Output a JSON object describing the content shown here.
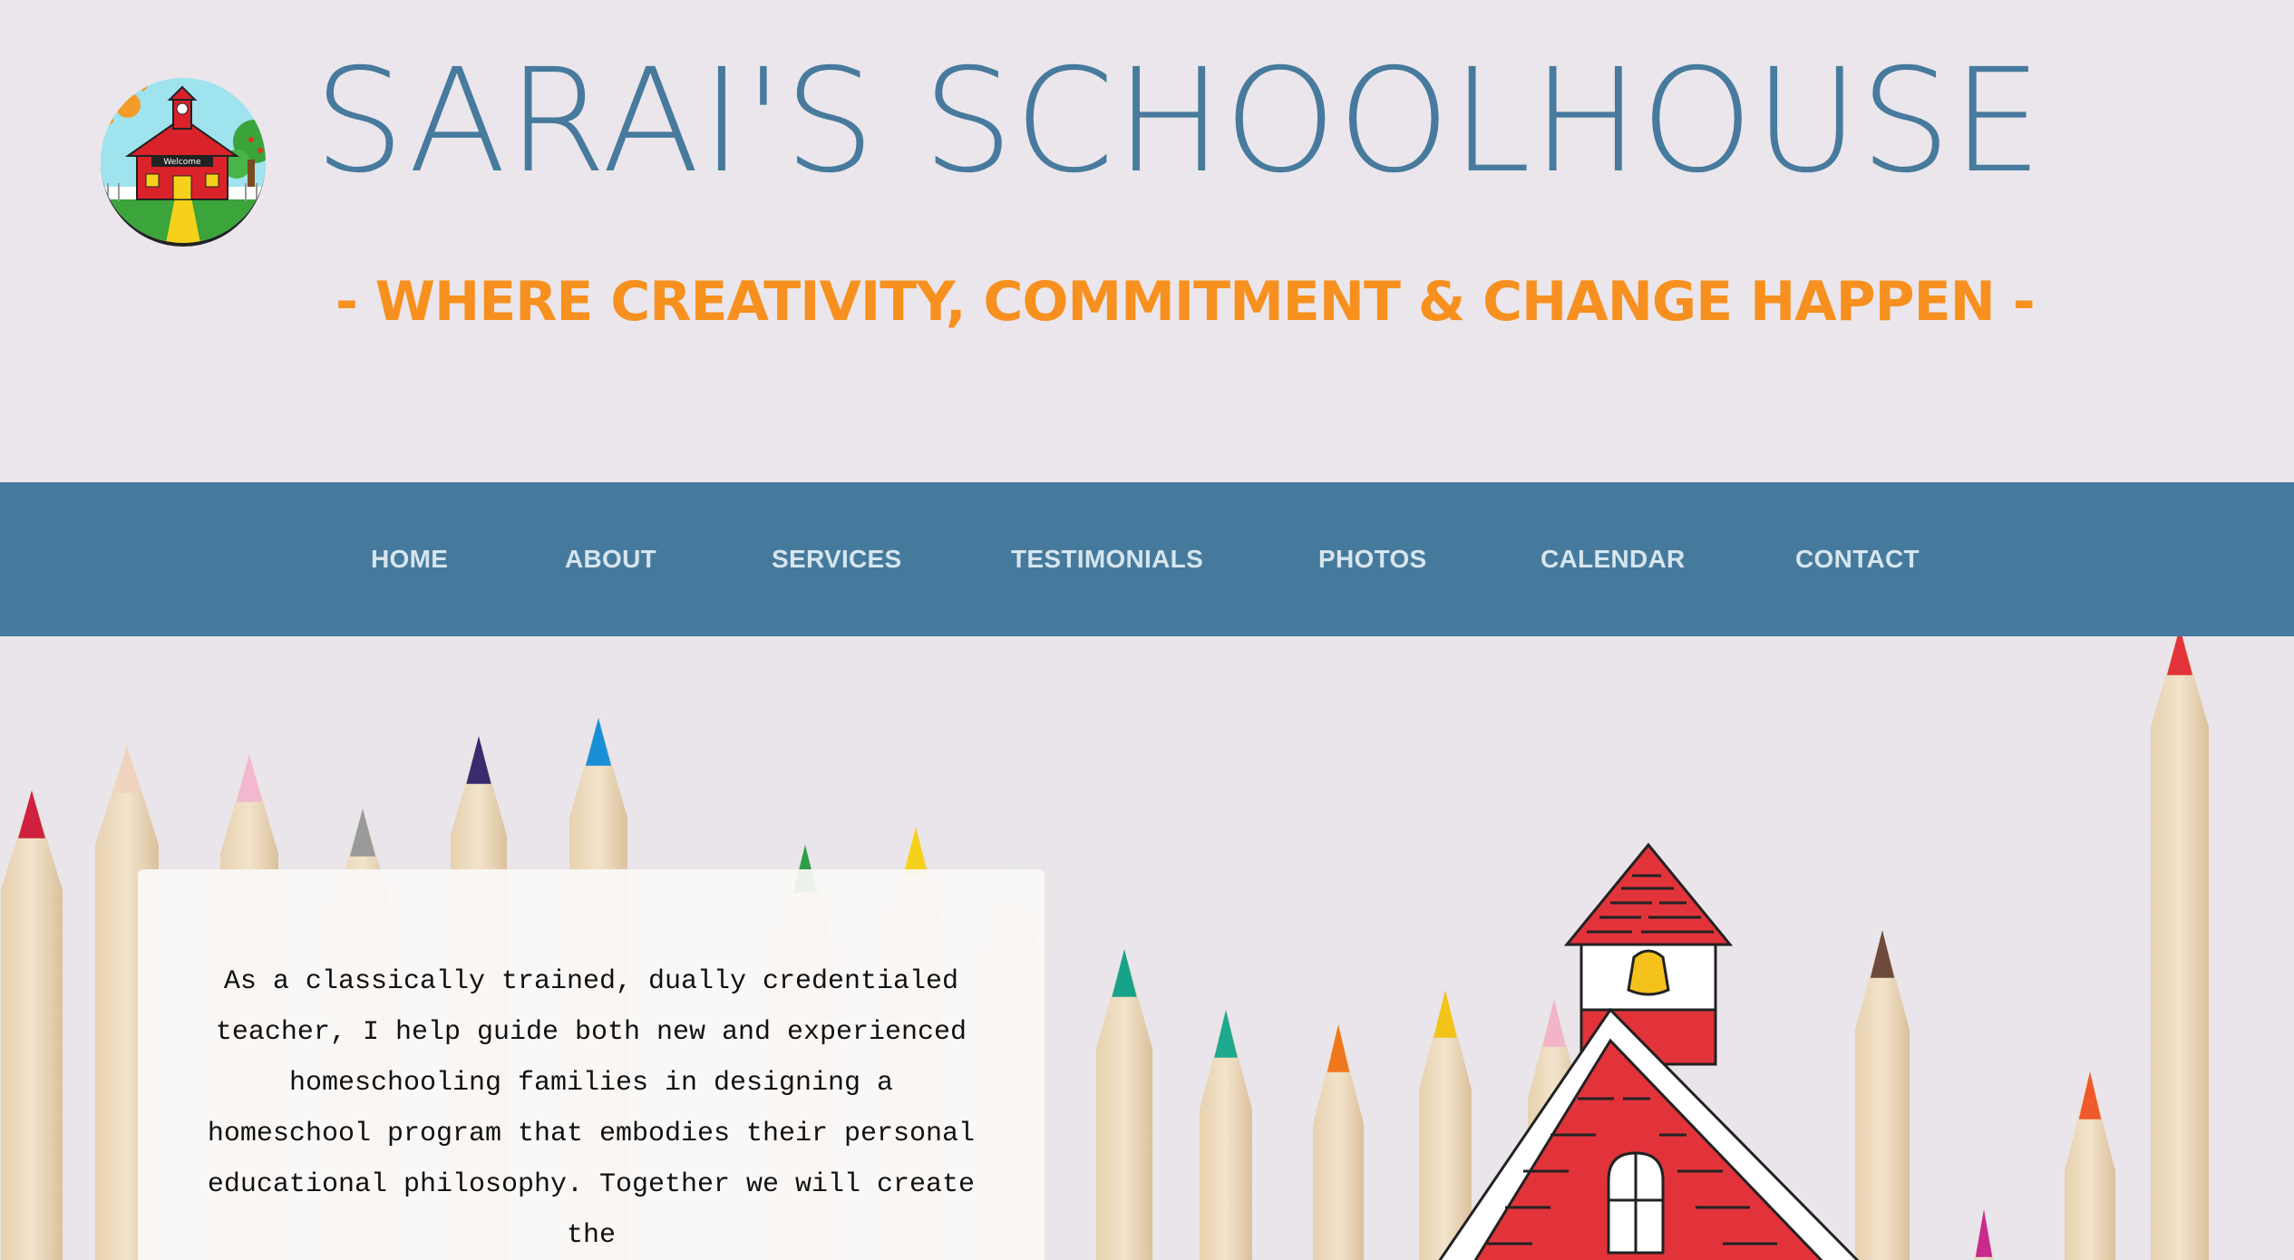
{
  "header": {
    "title": "SARAI'S SCHOOLHOUSE",
    "tagline": "- WHERE CREATIVITY, COMMITMENT & CHANGE HAPPEN -",
    "logo_sign": "Welcome"
  },
  "nav": {
    "items": [
      {
        "label": "HOME"
      },
      {
        "label": "ABOUT"
      },
      {
        "label": "SERVICES"
      },
      {
        "label": "TESTIMONIALS"
      },
      {
        "label": "PHOTOS"
      },
      {
        "label": "CALENDAR"
      },
      {
        "label": "CONTACT"
      }
    ]
  },
  "hero": {
    "intro_text": "As a classically trained, dually credentialed teacher, I help guide both new and experienced homeschooling families in designing a homeschool program that embodies their personal educational philosophy. Together we will create the"
  },
  "colors": {
    "title_blue": "#477a9d",
    "tagline_orange": "#f7901e",
    "nav_background": "#467a9d",
    "nav_text": "#d6e5ee",
    "page_background": "#e9e5ea"
  },
  "icons": [
    "schoolhouse-logo-icon",
    "colored-pencils-image",
    "schoolhouse-illustration-icon"
  ]
}
